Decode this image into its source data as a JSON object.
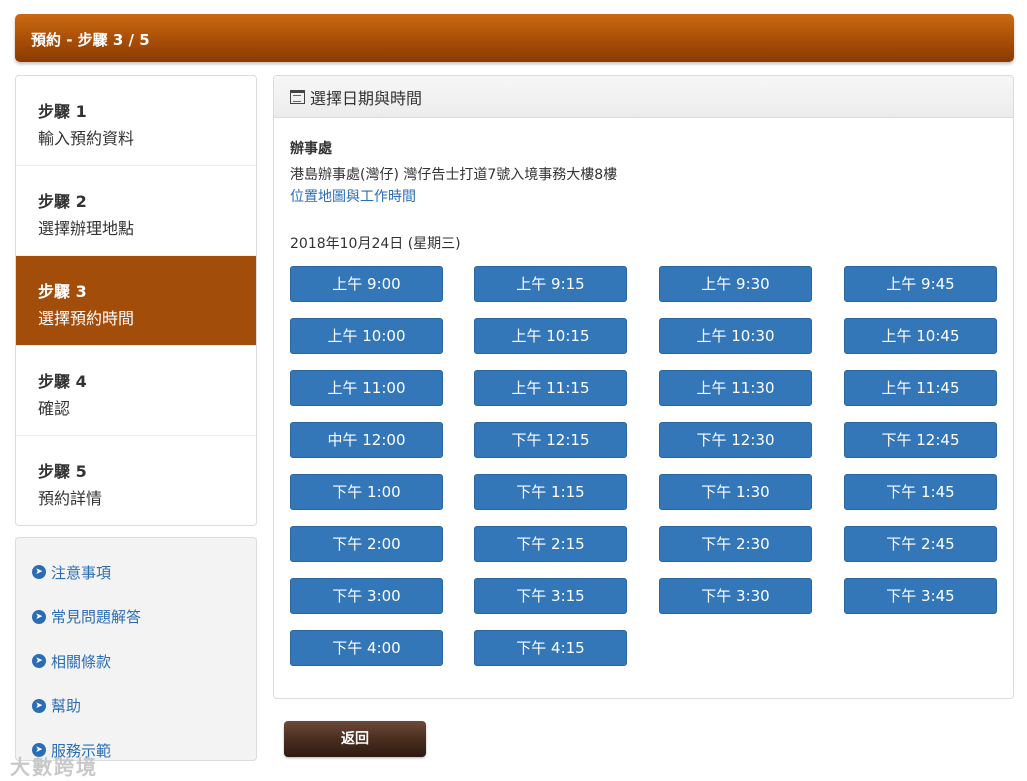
{
  "header": {
    "title": "預約 - 步驟 3 / 5"
  },
  "steps": [
    {
      "num": "步驟 1",
      "label": "輸入預約資料",
      "active": false
    },
    {
      "num": "步驟 2",
      "label": "選擇辦理地點",
      "active": false
    },
    {
      "num": "步驟 3",
      "label": "選擇預約時間",
      "active": true
    },
    {
      "num": "步驟 4",
      "label": "確認",
      "active": false
    },
    {
      "num": "步驟 5",
      "label": "預約詳情",
      "active": false
    }
  ],
  "links": [
    {
      "label": "注意事項",
      "icon": "arrow-circle-right-icon"
    },
    {
      "label": "常見問題解答",
      "icon": "arrow-circle-right-icon"
    },
    {
      "label": "相關條款",
      "icon": "arrow-circle-right-icon"
    },
    {
      "label": "幫助",
      "icon": "arrow-circle-right-icon"
    },
    {
      "label": "服務示範",
      "icon": "arrow-circle-right-icon"
    }
  ],
  "main": {
    "title": "選擇日期與時間",
    "office_heading": "辦事處",
    "office_address": "港島辦事處(灣仔) 灣仔告士打道7號入境事務大樓8樓",
    "office_link": "位置地圖與工作時間",
    "date": "2018年10月24日 (星期三)",
    "slots": [
      "上午 9:00",
      "上午 9:15",
      "上午 9:30",
      "上午 9:45",
      "上午 10:00",
      "上午 10:15",
      "上午 10:30",
      "上午 10:45",
      "上午 11:00",
      "上午 11:15",
      "上午 11:30",
      "上午 11:45",
      "中午 12:00",
      "下午 12:15",
      "下午 12:30",
      "下午 12:45",
      "下午 1:00",
      "下午 1:15",
      "下午 1:30",
      "下午 1:45",
      "下午 2:00",
      "下午 2:15",
      "下午 2:30",
      "下午 2:45",
      "下午 3:00",
      "下午 3:15",
      "下午 3:30",
      "下午 3:45",
      "下午 4:00",
      "下午 4:15"
    ]
  },
  "back_button": "返回",
  "watermark": "大數跨境",
  "colors": {
    "header_orange": "#a84d06",
    "active_step": "#a34d0a",
    "slot_blue": "#3377b8",
    "link_blue": "#2a6db5",
    "back_brown": "#4a2e20"
  }
}
